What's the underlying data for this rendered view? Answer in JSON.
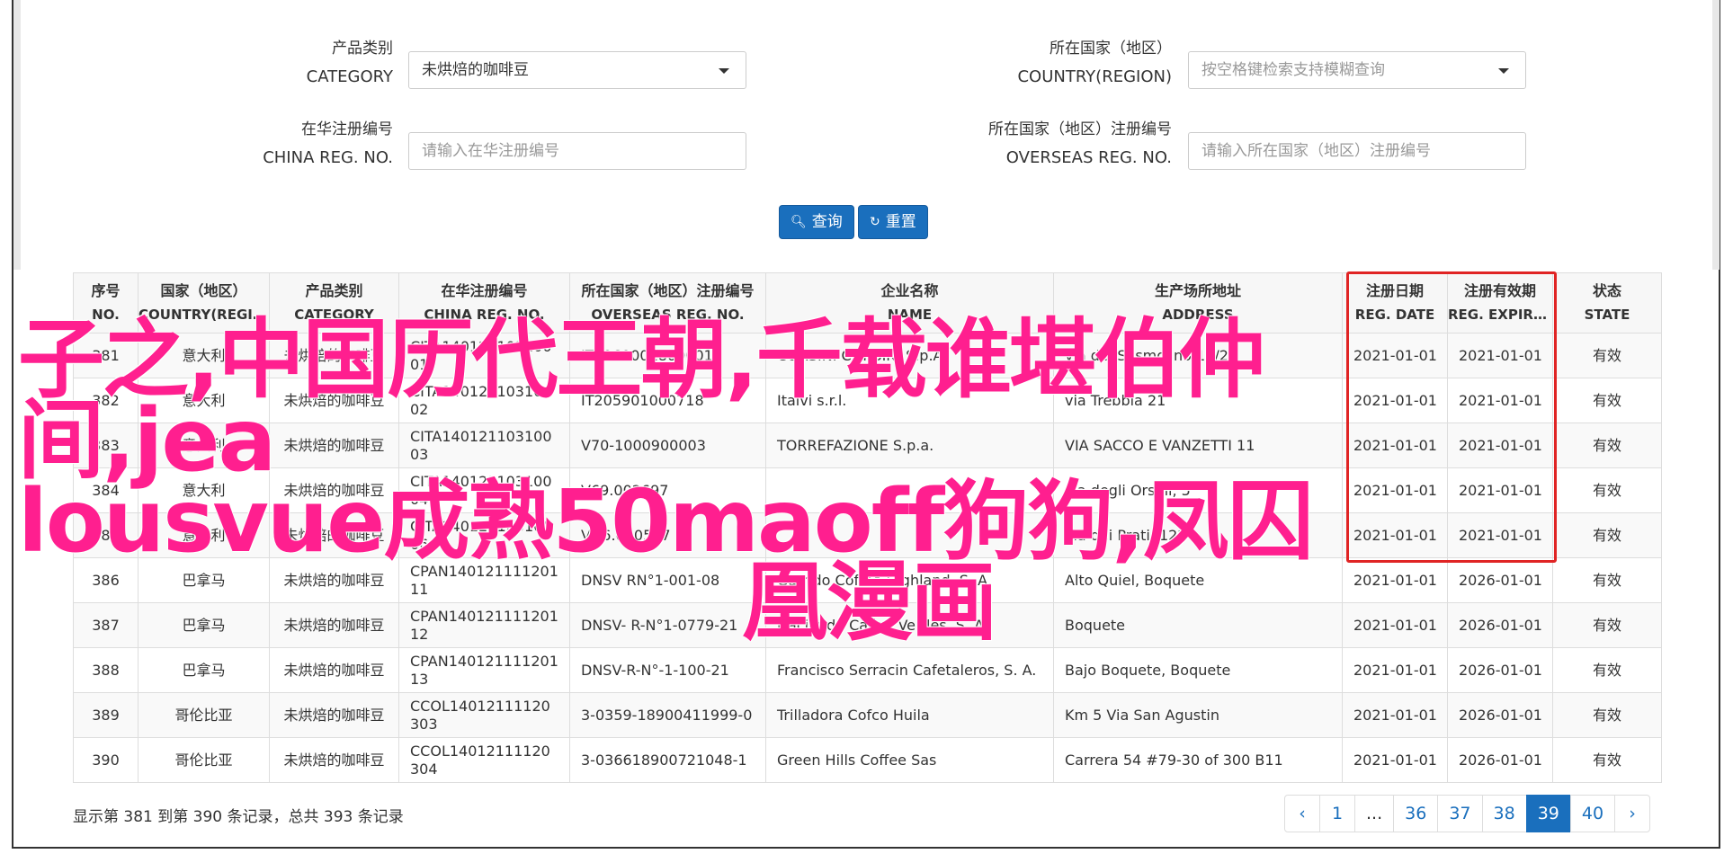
{
  "filters": {
    "category": {
      "label_cn": "产品类别",
      "label_en": "CATEGORY",
      "value": "未烘焙的咖啡豆"
    },
    "country": {
      "label_cn": "所在国家（地区）",
      "label_en": "COUNTRY(REGION)",
      "placeholder": "按空格键检索支持模糊查询"
    },
    "china_reg": {
      "label_cn": "在华注册编号",
      "label_en": "CHINA REG. NO.",
      "placeholder": "请输入在华注册编号"
    },
    "overseas_reg": {
      "label_cn": "所在国家（地区）注册编号",
      "label_en": "OVERSEAS REG. NO.",
      "placeholder": "请输入所在国家（地区）注册编号"
    },
    "query_label": "查询",
    "reset_label": "重置"
  },
  "table": {
    "headers": [
      {
        "cn": "序号",
        "en": "NO."
      },
      {
        "cn": "国家（地区）",
        "en": "COUNTRY(REGIO..."
      },
      {
        "cn": "产品类别",
        "en": "CATEGORY"
      },
      {
        "cn": "在华注册编号",
        "en": "CHINA REG. NO."
      },
      {
        "cn": "所在国家（地区）注册编号",
        "en": "OVERSEAS REG. NO."
      },
      {
        "cn": "企业名称",
        "en": "NAME"
      },
      {
        "cn": "生产场所地址",
        "en": "ADDRESS"
      },
      {
        "cn": "注册日期",
        "en": "REG. DATE"
      },
      {
        "cn": "注册有效期",
        "en": "REG. EXPIRE ..."
      },
      {
        "cn": "状态",
        "en": "STATE"
      }
    ],
    "rows": [
      {
        "no": "381",
        "country": "意大利",
        "category": "未烘焙的咖啡豆",
        "china_reg": "CITA14012110310001",
        "overseas_reg": "IT0960001800001",
        "name": "CORSINI CORSINI S.p.A.",
        "address": "via del Sesmolino 12/24",
        "reg_date": "2021-01-01",
        "expire": "2021-01-01",
        "state": "有效"
      },
      {
        "no": "382",
        "country": "意大利",
        "category": "未烘焙的咖啡豆",
        "china_reg": "CITA14012110310002",
        "overseas_reg": "IT205901000718",
        "name": "Italvi s.r.l.",
        "address": "via Trebbia 21",
        "reg_date": "2021-01-01",
        "expire": "2021-01-01",
        "state": "有效"
      },
      {
        "no": "383",
        "country": "意大利",
        "category": "未烘焙的咖啡豆",
        "china_reg": "CITA14012110310003",
        "overseas_reg": "V70-1000900003",
        "name": "TORREFAZIONE S.p.a.",
        "address": "VIA SACCO E VANZETTI 11",
        "reg_date": "2021-01-01",
        "expire": "2021-01-01",
        "state": "有效"
      },
      {
        "no": "384",
        "country": "意大利",
        "category": "未烘焙的咖啡豆",
        "china_reg": "CITA14012110310004",
        "overseas_reg": "V69.002697",
        "name": "",
        "address": "via degli Orsini, 5",
        "reg_date": "2021-01-01",
        "expire": "2021-01-01",
        "state": "有效"
      },
      {
        "no": "385",
        "country": "意大利",
        "category": "未烘焙的咖啡豆",
        "china_reg": "CITA14012110310006",
        "overseas_reg": "VD6.000527",
        "name": "",
        "address": "via dei Prati, 122",
        "reg_date": "2021-01-01",
        "expire": "2021-01-01",
        "state": "有效"
      },
      {
        "no": "386",
        "country": "巴拿马",
        "category": "未烘焙的咖啡豆",
        "china_reg": "CPAN14012111120111",
        "overseas_reg": "DNSV RN°1-001-08",
        "name": "Garrido Coffee Highland, S. A.",
        "address": "Alto Quiel, Boquete",
        "reg_date": "2021-01-01",
        "expire": "2026-01-01",
        "state": "有效"
      },
      {
        "no": "387",
        "country": "巴拿马",
        "category": "未烘焙的咖啡豆",
        "china_reg": "CPAN14012111120112",
        "overseas_reg": "DNSV- R-N°1-0779-21",
        "name": "Hacienda Cañas Verdes, S. A.",
        "address": "Boquete",
        "reg_date": "2021-01-01",
        "expire": "2026-01-01",
        "state": "有效"
      },
      {
        "no": "388",
        "country": "巴拿马",
        "category": "未烘焙的咖啡豆",
        "china_reg": "CPAN14012111120113",
        "overseas_reg": "DNSV-R-N°-1-100-21",
        "name": "Francisco Serracin Cafetaleros, S. A.",
        "address": "Bajo Boquete, Boquete",
        "reg_date": "2021-01-01",
        "expire": "2026-01-01",
        "state": "有效"
      },
      {
        "no": "389",
        "country": "哥伦比亚",
        "category": "未烘焙的咖啡豆",
        "china_reg": "CCOL14012111120303",
        "overseas_reg": "3-0359-18900411999-0",
        "name": "Trilladora Cofco Huila",
        "address": "Km 5 Via San Agustin",
        "reg_date": "2021-01-01",
        "expire": "2026-01-01",
        "state": "有效"
      },
      {
        "no": "390",
        "country": "哥伦比亚",
        "category": "未烘焙的咖啡豆",
        "china_reg": "CCOL14012111120304",
        "overseas_reg": "3-036618900721048-1",
        "name": "Green Hills Coffee Sas",
        "address": "Carrera 54 #79-30 of 300 B11",
        "reg_date": "2021-01-01",
        "expire": "2026-01-01",
        "state": "有效"
      }
    ]
  },
  "summary": "显示第 381 到第 390 条记录，总共 393 条记录",
  "pagination": [
    "‹",
    "1",
    "...",
    "36",
    "37",
    "38",
    "39",
    "40",
    "›"
  ],
  "pagination_active": "39",
  "overlay": {
    "line1": "子之,中国历代王朝,千载谁堪伯仲间,jea",
    "line2": "lousvue成熟50maoff狗狗,凤囚",
    "line3": "凰漫画"
  },
  "colors": {
    "primary": "#1a6fbd",
    "highlight_box": "#e02424",
    "overlay_text": "#ff1f8f"
  }
}
